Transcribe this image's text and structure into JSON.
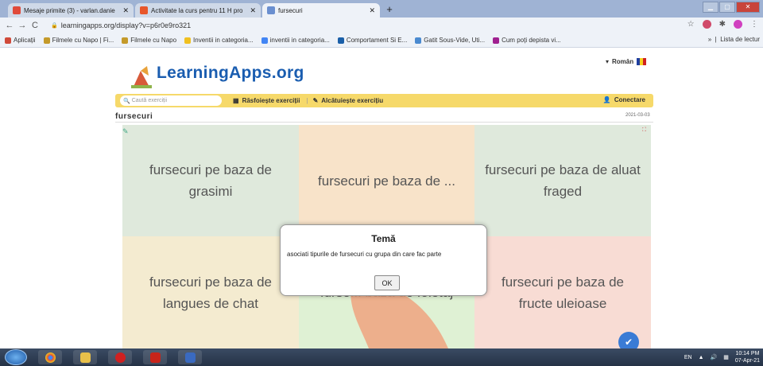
{
  "browser": {
    "tabs": [
      {
        "title": "Mesaje primite (3) - varlan.danie",
        "icon_color": "#e04a3a"
      },
      {
        "title": "Activitate la curs pentru 11 H pro",
        "icon_color": "#e8562a"
      },
      {
        "title": "fursecuri",
        "icon_color": "#6a8fd0"
      }
    ],
    "new_tab": "+",
    "url": "learningapps.org/display?v=p6r0e9ro321",
    "bookmarks": [
      {
        "label": "Aplicații",
        "color": "#d04a3a"
      },
      {
        "label": "Filmele cu Napo | Fi...",
        "color": "#c49a2a"
      },
      {
        "label": "Filmele cu Napo",
        "color": "#c49a2a"
      },
      {
        "label": "Inventii in categoria...",
        "color": "#f0c020"
      },
      {
        "label": "inventii in categoria...",
        "color": "#4285f4"
      },
      {
        "label": "Comportament Si E...",
        "color": "#1a5fa8"
      },
      {
        "label": "Gatit Sous-Vide, Uti...",
        "color": "#4a8ad0"
      },
      {
        "label": "Cum poți depista vi...",
        "color": "#a02090"
      }
    ],
    "bookmarks_more": "»",
    "reading_list": "Lista de lectur"
  },
  "site": {
    "logo": "LearningApps.org",
    "language": "Român",
    "search_placeholder": "Caută exerciții",
    "browse": "Răsfoiește exerciții",
    "create": "Alcătuiește exercițiu",
    "login": "Conectare",
    "app_title": "fursecuri",
    "app_date": "2021-03-03"
  },
  "cells": [
    "fursecuri pe baza de grasimi",
    "fursecuri pe baza de ...",
    "fursecuri pe baza de aluat fraged",
    "fursecuri pe baza de langues de chat",
    "furse... baza de foietaj",
    "fursecuri pe baza de fructe uleioase"
  ],
  "dialog": {
    "title": "Temă",
    "text": "asociati tipurile de fursecuri cu grupa din care fac parte",
    "ok": "OK"
  },
  "taskbar": {
    "lang": "EN",
    "time": "10:14 PM",
    "date": "07-Apr-21"
  }
}
